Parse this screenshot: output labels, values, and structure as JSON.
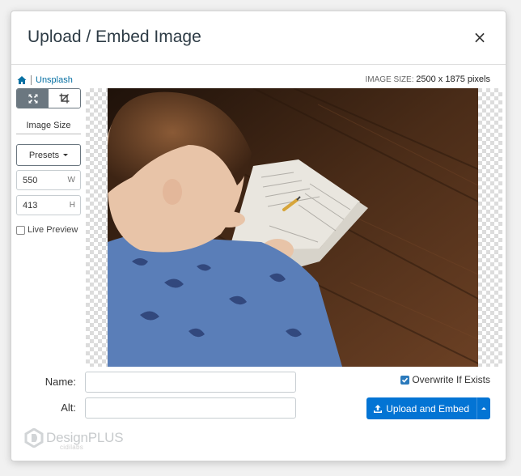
{
  "dialog": {
    "title": "Upload / Embed Image",
    "close_label": "×"
  },
  "breadcrumb": {
    "home_icon": "home-icon",
    "source": "Unsplash"
  },
  "image_size": {
    "label": "IMAGE SIZE:",
    "value": "2500 x 1875 pixels"
  },
  "toolbar": {
    "modes": [
      {
        "icon": "resize-icon",
        "active": true
      },
      {
        "icon": "crop-icon",
        "active": false
      }
    ]
  },
  "sizing": {
    "title": "Image Size",
    "presets_label": "Presets",
    "width_value": "550",
    "width_unit": "W",
    "height_value": "413",
    "height_unit": "H",
    "live_preview_label": "Live Preview",
    "live_preview_checked": false
  },
  "form": {
    "name_label": "Name:",
    "name_value": "",
    "alt_label": "Alt:",
    "alt_value": ""
  },
  "actions": {
    "overwrite_label": "Overwrite If Exists",
    "overwrite_checked": true,
    "upload_label": "Upload and Embed"
  },
  "branding": {
    "logo_text": "DesignPLUS",
    "logo_sub": "cidilabs"
  },
  "colors": {
    "primary": "#0374d4",
    "link": "#0770a3",
    "toggle_active": "#6b7780"
  }
}
